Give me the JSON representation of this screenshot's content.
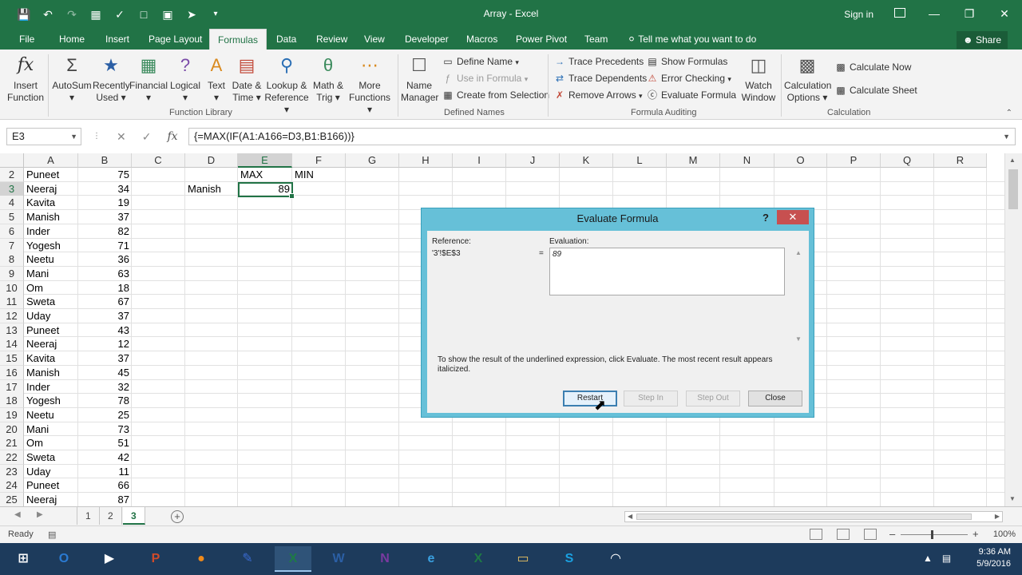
{
  "window": {
    "title": "Array - Excel",
    "signin": "Sign in"
  },
  "tabs": [
    {
      "label": "File"
    },
    {
      "label": "Home"
    },
    {
      "label": "Insert"
    },
    {
      "label": "Page Layout"
    },
    {
      "label": "Formulas"
    },
    {
      "label": "Data"
    },
    {
      "label": "Review"
    },
    {
      "label": "View"
    },
    {
      "label": "Developer"
    },
    {
      "label": "Macros"
    },
    {
      "label": "Power Pivot"
    },
    {
      "label": "Team"
    }
  ],
  "tellme": "Tell me what you want to do",
  "share": "Share",
  "ribbon": {
    "insert_function": [
      "Insert",
      "Function"
    ],
    "lib_buttons": [
      {
        "l1": "AutoSum",
        "l2": "▾"
      },
      {
        "l1": "Recently",
        "l2": "Used ▾"
      },
      {
        "l1": "Financial",
        "l2": "▾"
      },
      {
        "l1": "Logical",
        "l2": "▾"
      },
      {
        "l1": "Text",
        "l2": "▾"
      },
      {
        "l1": "Date &",
        "l2": "Time ▾"
      },
      {
        "l1": "Lookup &",
        "l2": "Reference ▾"
      },
      {
        "l1": "Math &",
        "l2": "Trig ▾"
      },
      {
        "l1": "More",
        "l2": "Functions ▾"
      }
    ],
    "function_library": "Function Library",
    "name_manager": [
      "Name",
      "Manager"
    ],
    "define_name": "Define Name",
    "use_in_formula": "Use in Formula",
    "create_from_selection": "Create from Selection",
    "defined_names": "Defined Names",
    "trace_precedents": "Trace Precedents",
    "trace_dependents": "Trace Dependents",
    "remove_arrows": "Remove Arrows",
    "show_formulas": "Show Formulas",
    "error_checking": "Error Checking",
    "evaluate_formula": "Evaluate Formula",
    "watch_window": [
      "Watch",
      "Window"
    ],
    "formula_auditing": "Formula Auditing",
    "calc_options": [
      "Calculation",
      "Options ▾"
    ],
    "calculate_now": "Calculate Now",
    "calculate_sheet": "Calculate Sheet",
    "calculation": "Calculation"
  },
  "formula_bar": {
    "namebox": "E3",
    "formula": "{=MAX(IF(A1:A166=D3,B1:B166))}"
  },
  "columns": [
    "A",
    "B",
    "C",
    "D",
    "E",
    "F",
    "G",
    "H",
    "I",
    "J",
    "K",
    "L",
    "M",
    "N",
    "O",
    "P",
    "Q",
    "R"
  ],
  "rows": [
    {
      "n": "2",
      "a": "Puneet",
      "b": "75"
    },
    {
      "n": "3",
      "a": "Neeraj",
      "b": "34"
    },
    {
      "n": "4",
      "a": "Kavita",
      "b": "19"
    },
    {
      "n": "5",
      "a": "Manish",
      "b": "37"
    },
    {
      "n": "6",
      "a": "Inder",
      "b": "82"
    },
    {
      "n": "7",
      "a": "Yogesh",
      "b": "71"
    },
    {
      "n": "8",
      "a": "Neetu",
      "b": "36"
    },
    {
      "n": "9",
      "a": "Mani",
      "b": "63"
    },
    {
      "n": "10",
      "a": "Om",
      "b": "18"
    },
    {
      "n": "11",
      "a": "Sweta",
      "b": "67"
    },
    {
      "n": "12",
      "a": "Uday",
      "b": "37"
    },
    {
      "n": "13",
      "a": "Puneet",
      "b": "43"
    },
    {
      "n": "14",
      "a": "Neeraj",
      "b": "12"
    },
    {
      "n": "15",
      "a": "Kavita",
      "b": "37"
    },
    {
      "n": "16",
      "a": "Manish",
      "b": "45"
    },
    {
      "n": "17",
      "a": "Inder",
      "b": "32"
    },
    {
      "n": "18",
      "a": "Yogesh",
      "b": "78"
    },
    {
      "n": "19",
      "a": "Neetu",
      "b": "25"
    },
    {
      "n": "20",
      "a": "Mani",
      "b": "73"
    },
    {
      "n": "21",
      "a": "Om",
      "b": "51"
    },
    {
      "n": "22",
      "a": "Sweta",
      "b": "42"
    },
    {
      "n": "23",
      "a": "Uday",
      "b": "11"
    },
    {
      "n": "24",
      "a": "Puneet",
      "b": "66"
    },
    {
      "n": "25",
      "a": "Neeraj",
      "b": "87"
    }
  ],
  "cells": {
    "e2": "MAX",
    "f2": "MIN",
    "d3": "Manish",
    "e3": "89"
  },
  "sheets": [
    {
      "label": "1"
    },
    {
      "label": "2"
    },
    {
      "label": "3"
    }
  ],
  "status": {
    "ready": "Ready",
    "zoom": "100%"
  },
  "dialog": {
    "title": "Evaluate Formula",
    "help": "?",
    "reference_label": "Reference:",
    "reference_value": "'3'!$E$3",
    "equals": "=",
    "evaluation_label": "Evaluation:",
    "evaluation_value": "89",
    "hint": "To show the result of the underlined expression, click Evaluate.  The most recent result appears italicized.",
    "restart": "Restart",
    "step_in": "Step In",
    "step_out": "Step Out",
    "close": "Close"
  },
  "taskbar": {
    "items": [
      {
        "name": "windows-start",
        "glyph": "⊞"
      },
      {
        "name": "outlook",
        "glyph": "O"
      },
      {
        "name": "video",
        "glyph": "▶"
      },
      {
        "name": "powerpoint",
        "glyph": "P"
      },
      {
        "name": "firefox",
        "glyph": "●"
      },
      {
        "name": "pen",
        "glyph": "✎"
      },
      {
        "name": "excel",
        "glyph": "X"
      },
      {
        "name": "word",
        "glyph": "W"
      },
      {
        "name": "onenote",
        "glyph": "N"
      },
      {
        "name": "internet-explorer",
        "glyph": "e"
      },
      {
        "name": "excel-2",
        "glyph": "X"
      },
      {
        "name": "file-explorer",
        "glyph": "▭"
      },
      {
        "name": "skype",
        "glyph": "S"
      },
      {
        "name": "wifi",
        "glyph": "◠"
      }
    ],
    "time": "9:36 AM",
    "date": "5/9/2016"
  },
  "colors": {
    "excel_green": "#217346",
    "dialog_frame": "#66c0d8",
    "close_red": "#c75050",
    "taskbar": "#1d3b5c"
  }
}
